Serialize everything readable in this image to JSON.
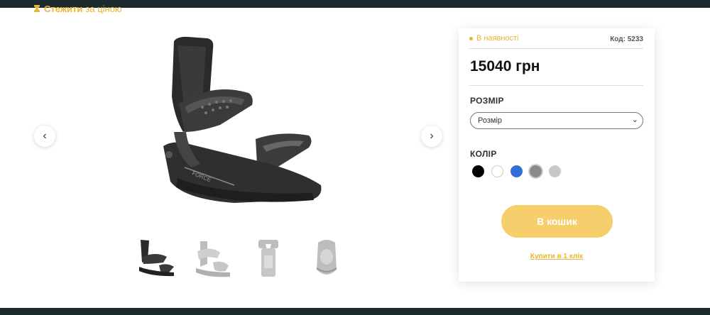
{
  "header": {
    "watch_bold": "Стежити",
    "watch_rest": "за ціною",
    "watch_icon": "hourglass-icon"
  },
  "gallery": {
    "prev_icon": "‹",
    "next_icon": "›",
    "thumbnails": [
      "thumb-binding-front",
      "thumb-binding-side",
      "thumb-highback-back",
      "thumb-baseplate-top"
    ]
  },
  "product": {
    "stock": "В наявності",
    "code": "Код: 5233",
    "price": "15040 грн",
    "size_label": "РОЗМІР",
    "size_select_value": "Розмір",
    "color_label": "КОЛІР",
    "colors": [
      "#000000",
      "#ffffff",
      "#2f6fd6",
      "#8a8a8a",
      "#c8c8c8"
    ],
    "cart_button": "В кошик",
    "one_click": "Купити в 1 клік"
  },
  "theme": {
    "accent": "#e8b52e",
    "button_bg": "#f6cf6c",
    "dark_bar": "#1b2a2c"
  }
}
